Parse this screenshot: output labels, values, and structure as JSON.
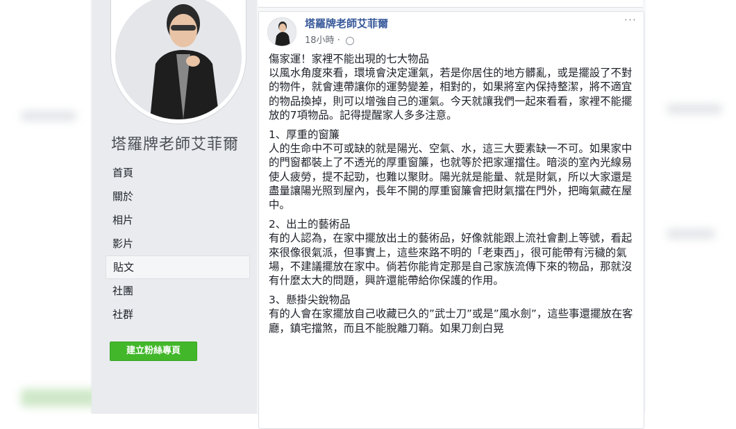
{
  "sidebar": {
    "page_name": "塔羅牌老師艾菲爾",
    "nav": [
      {
        "label": "首頁",
        "active": false
      },
      {
        "label": "關於",
        "active": false
      },
      {
        "label": "相片",
        "active": false
      },
      {
        "label": "影片",
        "active": false
      },
      {
        "label": "貼文",
        "active": true
      },
      {
        "label": "社團",
        "active": false
      },
      {
        "label": "社群",
        "active": false
      }
    ],
    "create_button": "建立粉絲專頁"
  },
  "post": {
    "author": "塔羅牌老師艾菲爾",
    "time": "18小時",
    "more": "···",
    "intro": "傷家運！家裡不能出現的七大物品\n以風水角度來看，環境會決定運氣，若是你居住的地方髒亂，或是擺設了不對的物件，就會連帶讓你的運勢變差，相對的，如果將室內保持整潔，將不適宜的物品換掉，則可以增強自己的運氣。今天就讓我們一起來看看，家裡不能擺放的7項物品。記得提醒家人多多注意。",
    "sections": [
      {
        "heading": "1、厚重的窗簾",
        "text": "人的生命中不可或缺的就是陽光、空氣、水，這三大要素缺一不可。如果家中的門窗都裝上了不透光的厚重窗簾，也就等於把家運擋住。暗淡的室內光線易使人疲勞，提不起勁，也難以聚財。陽光就是能量、就是財氣，所以大家還是盡量讓陽光照到屋內，長年不開的厚重窗簾會把財氣擋在門外，把晦氣藏在屋中。"
      },
      {
        "heading": "2、出土的藝術品",
        "text": "有的人認為，在家中擺放出土的藝術品，好像就能跟上流社會劃上等號，看起來很像很氣派，但事實上，這些來路不明的「老東西」，很可能帶有污穢的氣場，不建議擺放在家中。倘若你能肯定那是自己家族流傳下來的物品，那就沒有什麼太大的問題，興許還能帶給你保護的作用。"
      },
      {
        "heading": "3、懸掛尖銳物品",
        "text": "有的人會在家擺放自己收藏已久的”武士刀”或是”風水劍”，這些事還擺放在客廳，鎮宅擋煞，而且不能脫離刀鞘。如果刀劍白晃"
      }
    ]
  }
}
